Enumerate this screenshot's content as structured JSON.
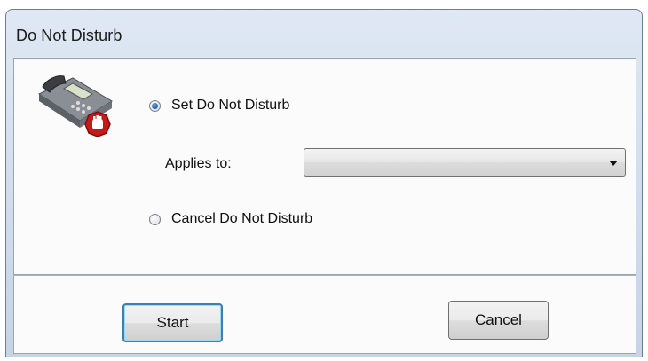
{
  "window": {
    "title": "Do Not Disturb"
  },
  "options": {
    "set_label": "Set Do Not Disturb",
    "set_checked": true,
    "cancel_label": "Cancel Do Not Disturb",
    "cancel_checked": false
  },
  "applies_to": {
    "label": "Applies to:",
    "value": ""
  },
  "buttons": {
    "start_label": "Start",
    "cancel_label": "Cancel"
  },
  "icons": {
    "main": "phone-stop-icon"
  },
  "colors": {
    "accent": "#1f5fa8",
    "stop_red": "#c61a1a",
    "focus_border": "#3c7fb1"
  }
}
